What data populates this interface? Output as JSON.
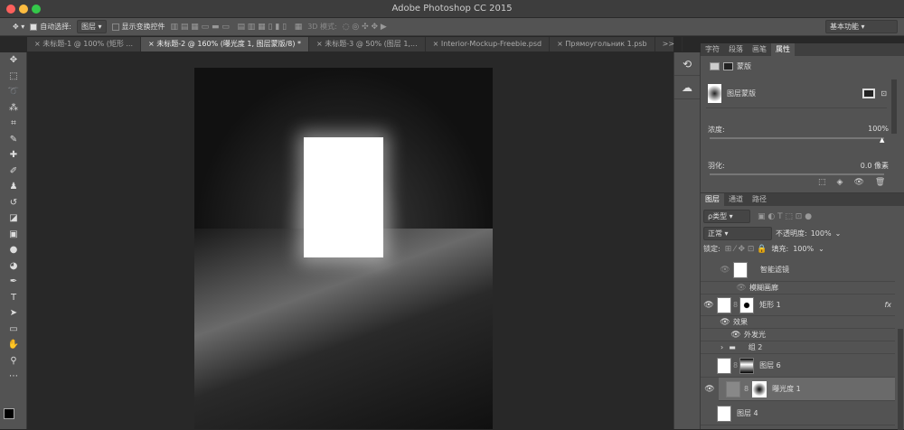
{
  "window": {
    "title": "Adobe Photoshop CC 2015"
  },
  "options": {
    "auto_select_label": "自动选择:",
    "auto_select_value": "图层",
    "show_transform_label": "显示变换控件",
    "mode3d_label": "3D 模式:",
    "workspace": "基本功能"
  },
  "tabs": [
    {
      "label": "未标题-1 @ 100% (矩形 ..."
    },
    {
      "label": "未标题-2 @ 160% (曝光度 1, 图层蒙版/8) *",
      "active": true
    },
    {
      "label": "未标题-3 @ 50% (图层 1,..."
    },
    {
      "label": "Interior-Mockup-Freebie.psd"
    },
    {
      "label": "Прямоугольник 1.psb"
    },
    {
      "label": ">>"
    }
  ],
  "tools": [
    "move",
    "marquee",
    "lasso",
    "magic-wand",
    "crop",
    "eyedropper",
    "healing",
    "brush",
    "stamp",
    "history-brush",
    "eraser",
    "gradient",
    "blur",
    "dodge",
    "pen",
    "type",
    "path-select",
    "rectangle",
    "hand",
    "zoom",
    "more"
  ],
  "properties": {
    "tabs": [
      "字符",
      "段落",
      "画笔",
      "属性"
    ],
    "active_tab": "属性",
    "header": "蒙版",
    "mask_label": "图层蒙版",
    "density_label": "浓度:",
    "density_value": "100%",
    "density": 100,
    "feather_label": "羽化:",
    "feather_value": "0.0 像素",
    "feather": 0
  },
  "layers_panel": {
    "tabs": [
      "图层",
      "通道",
      "路径"
    ],
    "filter": "ρ类型",
    "blend_mode": "正常",
    "opacity_label": "不透明度:",
    "opacity": "100%",
    "lock_label": "锁定:",
    "fill_label": "填充:",
    "fill": "100%",
    "layers": [
      {
        "name": "智能滤镜",
        "visible": true
      },
      {
        "name": "模糊画廊",
        "visible": true
      },
      {
        "name": "矩形 1",
        "visible": true,
        "fx": "fx"
      },
      {
        "name": "效果",
        "visible": true
      },
      {
        "name": "外发光",
        "visible": true
      },
      {
        "name": "组 2",
        "visible": false
      },
      {
        "name": "图层 6",
        "visible": false
      },
      {
        "name": "曝光度 1",
        "visible": true,
        "selected": true
      },
      {
        "name": "图层 4",
        "visible": false
      }
    ]
  }
}
